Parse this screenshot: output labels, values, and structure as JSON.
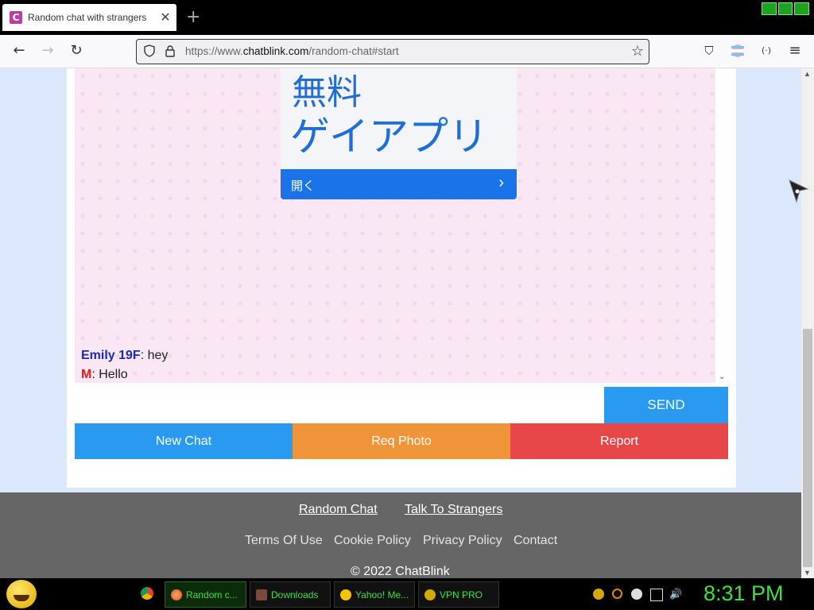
{
  "browser": {
    "tab_title": "Random chat with strangers",
    "tab_close": "✕",
    "new_tab": "+",
    "favicon_letter": "C",
    "url_prefix": "https://www.",
    "url_domain": "chatblink.com",
    "url_path": "/random-chat#start",
    "star": "☆",
    "back": "←",
    "forward": "→",
    "reload": "↻",
    "menu": "≡",
    "pocket": "⛉",
    "ext": "(·)"
  },
  "ad": {
    "line1": "無料",
    "line2": "ゲイアプリ",
    "button_label": "開く",
    "button_arrow": "›"
  },
  "chat": {
    "messages": [
      {
        "who": "Emily 19F",
        "text": ": hey"
      },
      {
        "who": "M",
        "text": ": Hello"
      }
    ],
    "input_value": "",
    "send_label": "SEND"
  },
  "actions": {
    "new_chat": "New Chat",
    "req_photo": "Req Photo",
    "report": "Report"
  },
  "footer": {
    "links_primary": [
      "Random Chat",
      "Talk To Strangers"
    ],
    "links_secondary": [
      "Terms Of Use",
      "Cookie Policy",
      "Privacy Policy",
      "Contact"
    ],
    "copyright": "© 2022 ChatBlink"
  },
  "taskbar": {
    "tasks": [
      {
        "label": "Random c...",
        "icon": "firefox-icon",
        "active": true
      },
      {
        "label": "Downloads",
        "icon": "downloads-icon",
        "active": false
      },
      {
        "label": "Yahoo! Me...",
        "icon": "yahoo-messenger-icon",
        "active": false
      },
      {
        "label": "VPN PRO",
        "icon": "vpn-icon",
        "active": false
      }
    ],
    "clock": "8:31 PM"
  },
  "colors": {
    "send": "#2a9af0",
    "new_chat": "#2a9af0",
    "req_photo": "#f0943a",
    "report": "#e8474a",
    "footer_bg": "#666666",
    "clock": "#3ee03e"
  }
}
